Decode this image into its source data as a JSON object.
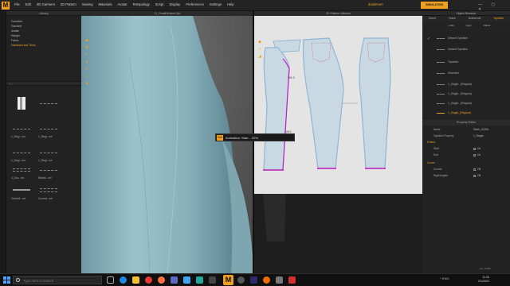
{
  "app": {
    "menu": [
      "File",
      "Edit",
      "3D Garment",
      "2D Pattern",
      "Sewing",
      "Materials",
      "Avatar",
      "Retopology",
      "Script",
      "Display",
      "Preferences",
      "Settings",
      "Help"
    ],
    "user_label": "dolahmert",
    "mode_badge": "SIMULATION",
    "window_controls": "— ▢ ✕",
    "accent_color": "#f0a020"
  },
  "library": {
    "title": "Library",
    "items": [
      "Favorites",
      "Garment",
      "Avatar",
      "Hanger",
      "Fabric",
      "Hardware and Trims"
    ],
    "active_index": 5,
    "folder_label": "\\ ...",
    "thumbnails": [
      {
        "label": "",
        "icon": "fabric-swatch-icon"
      },
      {
        "label": "",
        "icon": "dashed-line-icon"
      },
      {
        "label": "1_Singl...ezt",
        "icon": "dashed-line-icon"
      },
      {
        "label": "1_Singl...ezt",
        "icon": "dashed-line-icon"
      },
      {
        "label": "1_Singl...ezt",
        "icon": "dashed-line-icon"
      },
      {
        "label": "1_Singl...ezt",
        "icon": "dashed-line-icon"
      },
      {
        "label": "4_Dou...ezt",
        "icon": "double-dashed-icon"
      },
      {
        "label": "Blindst...ezt",
        "icon": "dashed-line-icon"
      },
      {
        "label": "Overedt...ezt",
        "icon": "overedge-icon"
      },
      {
        "label": "Coverst...ezt",
        "icon": "coverstitch-icon"
      }
    ]
  },
  "view3d": {
    "title": "11_SmallVinatoc.Zpr",
    "tools": [
      "select-icon",
      "transform-icon",
      "fold-icon",
      "pin-icon",
      "brush-icon",
      "avatar-icon",
      "hanger-icon"
    ]
  },
  "view2d": {
    "title": "2D Pattern Window",
    "labels": [
      "101.9",
      "128.2"
    ]
  },
  "progress": {
    "icon_text": "Edit",
    "text": "Animation: Start... 20%"
  },
  "object_browser": {
    "title": "Object Browser",
    "tabs": [
      "Scene",
      "Fabric",
      "Buttonhole",
      "Topstitch"
    ],
    "active_tab": "Topstitch",
    "tools": [
      "+ Add",
      "Copy",
      "Delete"
    ],
    "items": [
      {
        "label": "Default Topstitch",
        "highlight": false
      },
      {
        "label": "Default Topstitch",
        "highlight": false
      },
      {
        "label": "Topstitch",
        "highlight": false
      },
      {
        "label": "Seamline",
        "highlight": false
      },
      {
        "label": "1_Single...(Regular)",
        "highlight": false
      },
      {
        "label": "1_Single...(Regular)",
        "highlight": false
      },
      {
        "label": "1_Single...(Regular)",
        "highlight": false
      },
      {
        "label": "1_Single_(Regular)",
        "highlight": true
      }
    ]
  },
  "property_editor": {
    "title": "Property Editor",
    "rows": [
      {
        "key": "Name",
        "value": "Stitch_21390...",
        "section": false
      },
      {
        "key": "Topstitch Property",
        "value": "1_Single...",
        "section": false
      },
      {
        "key": "Extend",
        "value": "",
        "section": true
      },
      {
        "key": "Start",
        "value": "On",
        "section": false
      },
      {
        "key": "End",
        "value": "On",
        "section": false
      },
      {
        "key": "Corner",
        "value": "",
        "section": true
      },
      {
        "key": "Curved",
        "value": "Off",
        "section": false
      },
      {
        "key": "Right Angled",
        "value": "Off",
        "section": false
      }
    ],
    "footer": "1px 10MB"
  },
  "taskbar": {
    "search_placeholder": "Type here to search",
    "apps": [
      "task-view-icon",
      "edge-icon",
      "file-explorer-icon",
      "chrome-icon",
      "firefox-icon",
      "store-icon",
      "mail-icon",
      "photos-icon",
      "marvelous-designer-icon",
      "obs-icon",
      "premiere-icon",
      "media-player-icon",
      "settings-icon",
      "youtube-icon"
    ],
    "tray": "^ ENG",
    "time": "11:33",
    "date": "2/1/2021"
  }
}
